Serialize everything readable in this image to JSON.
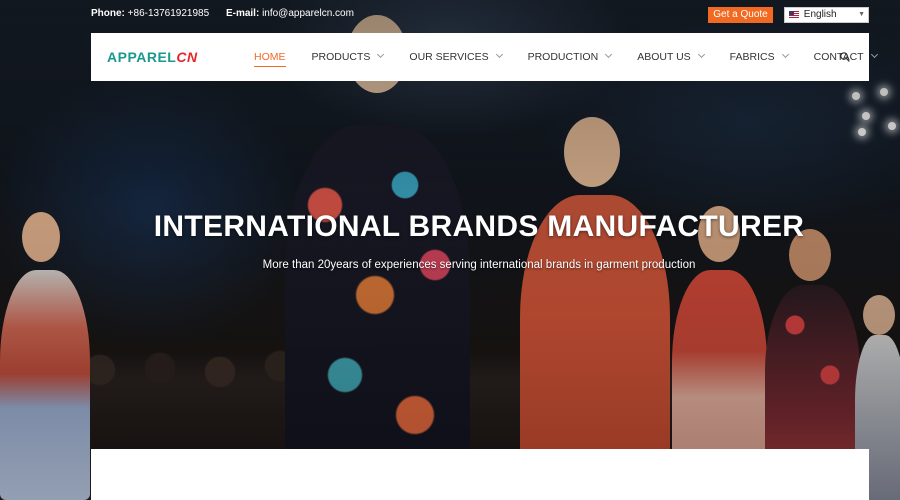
{
  "topbar": {
    "phone_label": "Phone:",
    "phone_value": "+86-13761921985",
    "email_label": "E-mail:",
    "email_value": "info@apparelcn.com",
    "quote_button": "Get a Quote",
    "language": "English",
    "language_icon": "us-flag-icon"
  },
  "logo": {
    "part1": "APPAREL",
    "part2": "CN",
    "color1": "#1a9a8e",
    "color2": "#e5262b"
  },
  "nav": {
    "items": [
      {
        "label": "HOME",
        "active": true
      },
      {
        "label": "PRODUCTS",
        "dropdown": true
      },
      {
        "label": "OUR SERVICES",
        "dropdown": true
      },
      {
        "label": "PRODUCTION",
        "dropdown": true
      },
      {
        "label": "ABOUT US",
        "dropdown": true
      },
      {
        "label": "FABRICS",
        "dropdown": true
      },
      {
        "label": "CONTACT",
        "dropdown": true
      }
    ],
    "search_icon": "search-icon",
    "accent_color": "#f26a21"
  },
  "hero": {
    "title": "INTERNATIONAL BRANDS MANUFACTURER",
    "subtitle": "More than 20years of experiences serving international brands in garment production",
    "background": "fashion runway photo"
  }
}
